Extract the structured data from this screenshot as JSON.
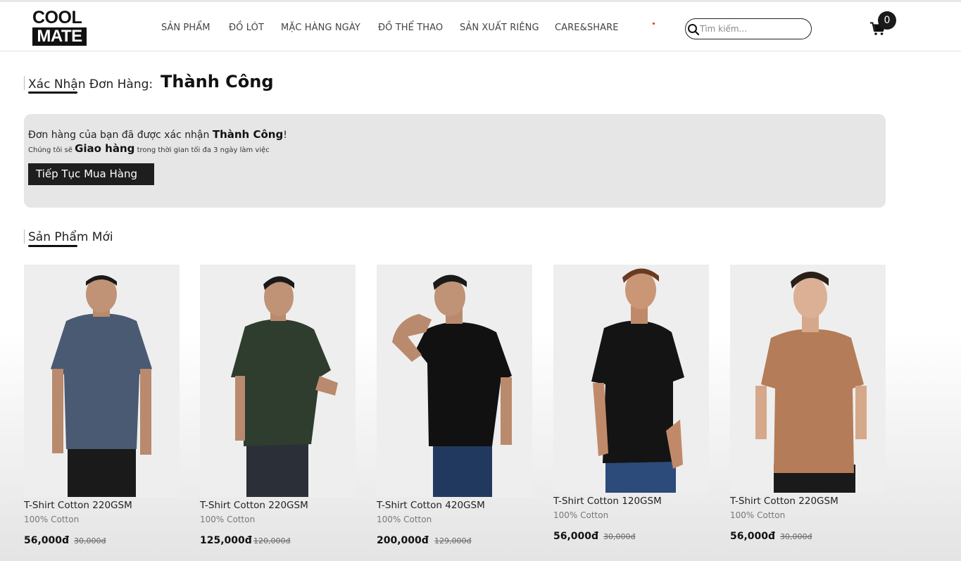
{
  "brand": {
    "logo_top": "COOL",
    "logo_bottom": "MATE"
  },
  "nav": [
    {
      "label": "SẢN PHẨM"
    },
    {
      "label": "ĐỒ LÓT"
    },
    {
      "label": "MẶC HÀNG NGÀY"
    },
    {
      "label": "ĐỒ THỂ THAO"
    },
    {
      "label": "SẢN XUẤT RIÊNG"
    },
    {
      "label": "CARE&SHARE"
    }
  ],
  "search": {
    "placeholder": "Tìm kiếm...",
    "value": "",
    "icon": "search-icon"
  },
  "cart": {
    "count": "0",
    "icon": "cart-icon"
  },
  "confirm": {
    "title_label": "Xác Nhận Đơn Hàng:",
    "title_strong": "Thành Công",
    "line1_prefix": "Đơn hàng của bạn đã được xác nhận ",
    "line1_strong": "Thành Công",
    "line1_suffix": "!",
    "line2_prefix": "Chúng tôi sẽ ",
    "line2_strong": "Giao hàng",
    "line2_suffix": " trong thời gian tối đa 3 ngày làm việc",
    "button_label": "Tiếp Tục Mua Hàng"
  },
  "new_products": {
    "title": "Sản Phẩm Mới",
    "items": [
      {
        "name": "T-Shirt Cotton 220GSM",
        "material": "100% Cotton",
        "price": "56,000đ",
        "old_price": "30,000đ",
        "shirt_color": "#4a5a72"
      },
      {
        "name": "T-Shirt Cotton 220GSM",
        "material": "100% Cotton",
        "price": "125,000đ",
        "old_price": "120,000đ",
        "shirt_color": "#2e3d2e"
      },
      {
        "name": "T-Shirt Cotton 420GSM",
        "material": "100% Cotton",
        "price": "200,000đ",
        "old_price": "129,000đ",
        "shirt_color": "#111111"
      },
      {
        "name": "T-Shirt Cotton 120GSM",
        "material": "100% Cotton",
        "price": "56,000đ",
        "old_price": "30,000đ",
        "shirt_color": "#141414"
      },
      {
        "name": "T-Shirt Cotton 220GSM",
        "material": "100% Cotton",
        "price": "56,000đ",
        "old_price": "30,000đ",
        "shirt_color": "#b47c58"
      }
    ]
  }
}
